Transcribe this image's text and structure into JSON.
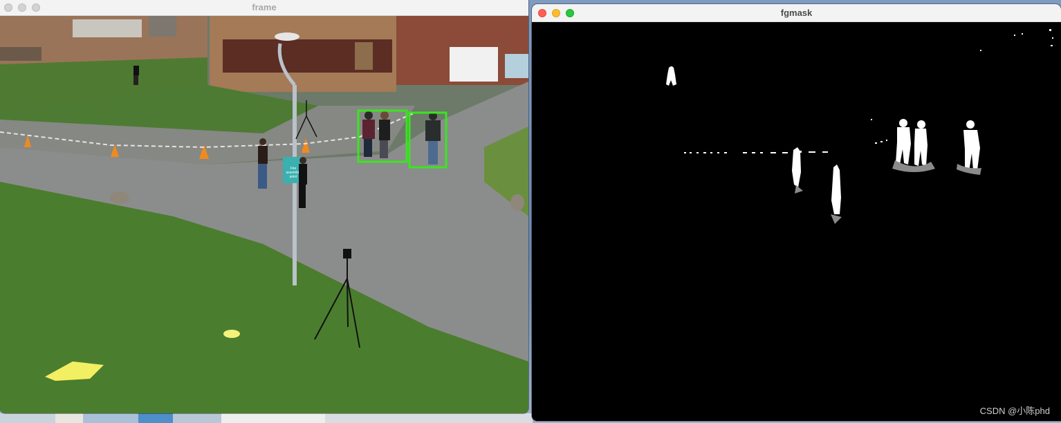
{
  "frame_window": {
    "title": "frame",
    "active": false,
    "scene": {
      "sign_text": [
        "Fire",
        "assembly",
        "point"
      ],
      "detections": [
        {
          "label": "pedestrian-pair"
        },
        {
          "label": "pedestrian-single"
        }
      ],
      "box_color": "#39e61e"
    }
  },
  "fgmask_window": {
    "title": "fgmask",
    "active": true,
    "watermark": "CSDN @小陈phd"
  },
  "colors": {
    "close": "#ff5f57",
    "minimize": "#febc2e",
    "zoom": "#28c840",
    "inactive_button": "#d3d3d3",
    "mask_background": "#000000",
    "mask_foreground": "#ffffff",
    "mask_shadow": "#8a8a8a"
  }
}
